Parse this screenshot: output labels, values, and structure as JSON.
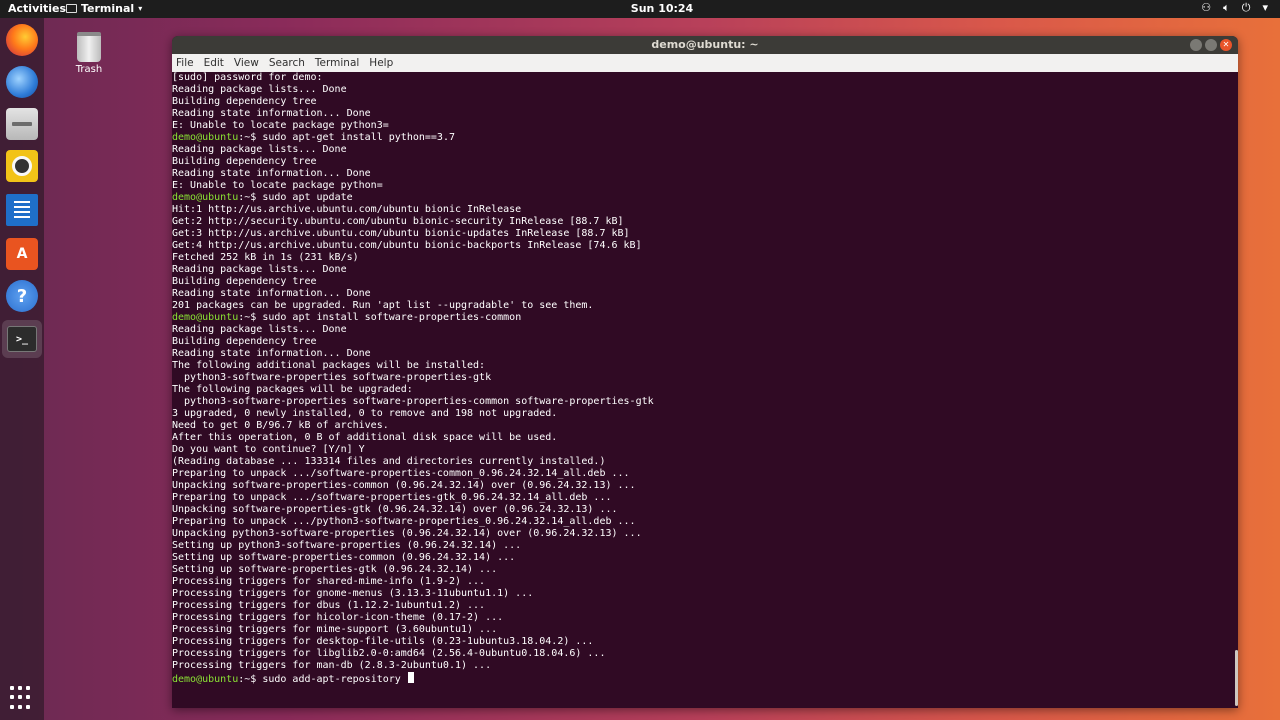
{
  "topbar": {
    "activities": "Activities",
    "app_menu": "Terminal",
    "clock": "Sun 10:24"
  },
  "desktop": {
    "trash_label": "Trash"
  },
  "dock": {
    "items": [
      "firefox-icon",
      "thunderbird-icon",
      "files-icon",
      "rhythmbox-icon",
      "libreoffice-writer-icon",
      "ubuntu-software-icon",
      "help-icon",
      "terminal-icon"
    ]
  },
  "window": {
    "title": "demo@ubuntu: ~",
    "menu": [
      "File",
      "Edit",
      "View",
      "Search",
      "Terminal",
      "Help"
    ]
  },
  "terminal": {
    "lines": [
      {
        "text": "[sudo] password for demo:"
      },
      {
        "text": "Reading package lists... Done"
      },
      {
        "text": "Building dependency tree"
      },
      {
        "text": "Reading state information... Done"
      },
      {
        "text": "E: Unable to locate package python3="
      },
      {
        "prompt": "demo@ubuntu",
        "path": ":~$ ",
        "text": "sudo apt-get install python==3.7"
      },
      {
        "text": "Reading package lists... Done"
      },
      {
        "text": "Building dependency tree"
      },
      {
        "text": "Reading state information... Done"
      },
      {
        "text": "E: Unable to locate package python="
      },
      {
        "prompt": "demo@ubuntu",
        "path": ":~$ ",
        "text": "sudo apt update"
      },
      {
        "text": "Hit:1 http://us.archive.ubuntu.com/ubuntu bionic InRelease"
      },
      {
        "text": "Get:2 http://security.ubuntu.com/ubuntu bionic-security InRelease [88.7 kB]"
      },
      {
        "text": "Get:3 http://us.archive.ubuntu.com/ubuntu bionic-updates InRelease [88.7 kB]"
      },
      {
        "text": "Get:4 http://us.archive.ubuntu.com/ubuntu bionic-backports InRelease [74.6 kB]"
      },
      {
        "text": "Fetched 252 kB in 1s (231 kB/s)"
      },
      {
        "text": "Reading package lists... Done"
      },
      {
        "text": "Building dependency tree"
      },
      {
        "text": "Reading state information... Done"
      },
      {
        "text": "201 packages can be upgraded. Run 'apt list --upgradable' to see them."
      },
      {
        "prompt": "demo@ubuntu",
        "path": ":~$ ",
        "text": "sudo apt install software-properties-common"
      },
      {
        "text": "Reading package lists... Done"
      },
      {
        "text": "Building dependency tree"
      },
      {
        "text": "Reading state information... Done"
      },
      {
        "text": "The following additional packages will be installed:"
      },
      {
        "text": "  python3-software-properties software-properties-gtk"
      },
      {
        "text": "The following packages will be upgraded:"
      },
      {
        "text": "  python3-software-properties software-properties-common software-properties-gtk"
      },
      {
        "text": "3 upgraded, 0 newly installed, 0 to remove and 198 not upgraded."
      },
      {
        "text": "Need to get 0 B/96.7 kB of archives."
      },
      {
        "text": "After this operation, 0 B of additional disk space will be used."
      },
      {
        "text": "Do you want to continue? [Y/n] Y"
      },
      {
        "text": "(Reading database ... 133314 files and directories currently installed.)"
      },
      {
        "text": "Preparing to unpack .../software-properties-common_0.96.24.32.14_all.deb ..."
      },
      {
        "text": "Unpacking software-properties-common (0.96.24.32.14) over (0.96.24.32.13) ..."
      },
      {
        "text": "Preparing to unpack .../software-properties-gtk_0.96.24.32.14_all.deb ..."
      },
      {
        "text": "Unpacking software-properties-gtk (0.96.24.32.14) over (0.96.24.32.13) ..."
      },
      {
        "text": "Preparing to unpack .../python3-software-properties_0.96.24.32.14_all.deb ..."
      },
      {
        "text": "Unpacking python3-software-properties (0.96.24.32.14) over (0.96.24.32.13) ..."
      },
      {
        "text": "Setting up python3-software-properties (0.96.24.32.14) ..."
      },
      {
        "text": "Setting up software-properties-common (0.96.24.32.14) ..."
      },
      {
        "text": "Setting up software-properties-gtk (0.96.24.32.14) ..."
      },
      {
        "text": "Processing triggers for shared-mime-info (1.9-2) ..."
      },
      {
        "text": "Processing triggers for gnome-menus (3.13.3-11ubuntu1.1) ..."
      },
      {
        "text": "Processing triggers for dbus (1.12.2-1ubuntu1.2) ..."
      },
      {
        "text": "Processing triggers for hicolor-icon-theme (0.17-2) ..."
      },
      {
        "text": "Processing triggers for mime-support (3.60ubuntu1) ..."
      },
      {
        "text": "Processing triggers for desktop-file-utils (0.23-1ubuntu3.18.04.2) ..."
      },
      {
        "text": "Processing triggers for libglib2.0-0:amd64 (2.56.4-0ubuntu0.18.04.6) ..."
      },
      {
        "text": "Processing triggers for man-db (2.8.3-2ubuntu0.1) ..."
      },
      {
        "prompt": "demo@ubuntu",
        "path": ":~$ ",
        "text": "sudo add-apt-repository ",
        "cursor": true
      }
    ]
  }
}
